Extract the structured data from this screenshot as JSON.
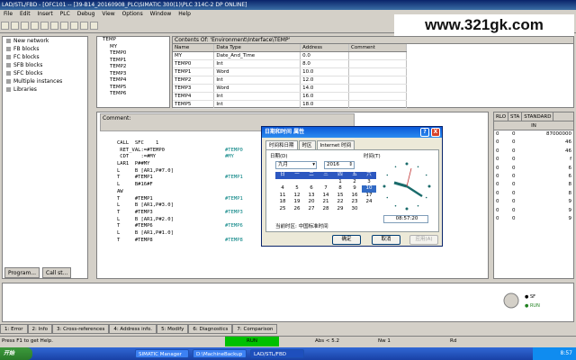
{
  "window": {
    "title": "LAD/STL/FBD - [OFC101 -- [39-B14_20160908_PLC\\SIMATIC 300(1)\\PLC 314C-2 DP  ONLINE]"
  },
  "menubar": [
    "File",
    "Edit",
    "Insert",
    "PLC",
    "Debug",
    "View",
    "Options",
    "Window",
    "Help"
  ],
  "watermark": "www.321gk.com",
  "tree": {
    "items": [
      "New network",
      "FB blocks",
      "FC blocks",
      "SFB blocks",
      "SFC blocks",
      "Multiple instances",
      "Libraries"
    ],
    "tabs": [
      "Program...",
      "Call st..."
    ]
  },
  "interface_tree": {
    "root": "TEMP",
    "items": [
      "MY",
      "TEMP0",
      "TEMP1",
      "TEMP2",
      "TEMP3",
      "TEMP4",
      "TEMP5",
      "TEMP6"
    ]
  },
  "interface_table": {
    "contents_label": "Contents Of: 'Environment\\Interface\\TEMP'",
    "headers": [
      "Name",
      "Data Type",
      "Address",
      "Comment"
    ],
    "rows": [
      [
        "MY",
        "Date_And_Time",
        "0.0",
        ""
      ],
      [
        "TEMP0",
        "Int",
        "8.0",
        ""
      ],
      [
        "TEMP1",
        "Word",
        "10.0",
        ""
      ],
      [
        "TEMP2",
        "Int",
        "12.0",
        ""
      ],
      [
        "TEMP3",
        "Word",
        "14.0",
        ""
      ],
      [
        "TEMP4",
        "Int",
        "16.0",
        ""
      ],
      [
        "TEMP5",
        "Int",
        "18.0",
        ""
      ]
    ]
  },
  "editor": {
    "comment_label": "Comment:",
    "code": [
      [
        "CALL  SFC    1",
        ""
      ],
      [
        " RET_VAL:=#TEMP0",
        "#TEMP0"
      ],
      [
        " CDT    :=#MY",
        "#MY"
      ],
      [
        "LAR1  P##MY",
        ""
      ],
      [
        "L     B [AR1,P#7.0]",
        ""
      ],
      [
        "T     #TEMP1",
        "#TEMP1"
      ],
      [
        "L     B#16#F",
        ""
      ],
      [
        "AW",
        ""
      ],
      [
        "T     #TEMP1",
        "#TEMP1"
      ],
      [
        "L     B [AR1,P#3.0]",
        ""
      ],
      [
        "T     #TEMP3",
        "#TEMP3"
      ],
      [
        "L     B [AR1,P#2.0]",
        ""
      ],
      [
        "T     #TEMP6",
        "#TEMP6"
      ],
      [
        "L     B [AR1,P#1.0]",
        ""
      ],
      [
        "T     #TEMP8",
        "#TEMP8"
      ]
    ]
  },
  "status_panel": {
    "headers": [
      "RLO",
      "STA",
      "STANDARD"
    ],
    "subheader": "IN",
    "rows": [
      [
        "0",
        "0",
        "87000000"
      ],
      [
        "0",
        "0",
        "46"
      ],
      [
        "0",
        "0",
        "46"
      ],
      [
        "0",
        "0",
        "f"
      ],
      [
        "0",
        "0",
        "6"
      ],
      [
        "0",
        "0",
        "6"
      ],
      [
        "0",
        "0",
        "8"
      ],
      [
        "0",
        "0",
        "8"
      ],
      [
        "0",
        "0",
        "9"
      ],
      [
        "0",
        "0",
        "9"
      ],
      [
        "0",
        "0",
        "9"
      ]
    ]
  },
  "dialog": {
    "title": "日期和时间 属性",
    "help_btn": "?",
    "close_btn": "X",
    "tabs": [
      "时间和日期",
      "时区",
      "Internet 时间"
    ],
    "date_label": "日期(D)",
    "time_label": "时间(T)",
    "month": "九月",
    "year": "2016",
    "weekdays": [
      "日",
      "一",
      "二",
      "三",
      "四",
      "五",
      "六"
    ],
    "days": [
      "",
      "",
      "",
      "",
      "1",
      "2",
      "3",
      "4",
      "5",
      "6",
      "7",
      "8",
      "9",
      "10",
      "11",
      "12",
      "13",
      "14",
      "15",
      "16",
      "17",
      "18",
      "19",
      "20",
      "21",
      "22",
      "23",
      "24",
      "25",
      "26",
      "27",
      "28",
      "29",
      "30",
      ""
    ],
    "selected_day": "10",
    "time_value": "08:57:20",
    "timezone_text": "当前时区:  中国标准时间",
    "ok": "确定",
    "cancel": "取消",
    "apply": "应用(A)"
  },
  "bottom_tabs": [
    "1: Error",
    "2: Info",
    "3: Cross-references",
    "4: Address info.",
    "5: Modify",
    "6: Diagnostics",
    "7: Comparison"
  ],
  "statusbar": {
    "help": "Press F1 to get Help.",
    "run": "RUN",
    "abs": "Abs < 5.2",
    "nw": "Nw 1",
    "rd": "Rd"
  },
  "taskbar": {
    "start": "开始",
    "tasks": [
      "SIMATIC Manager",
      "D:\\MachineBackup",
      "LAD/STL/FBD"
    ],
    "clock": "8:57"
  }
}
